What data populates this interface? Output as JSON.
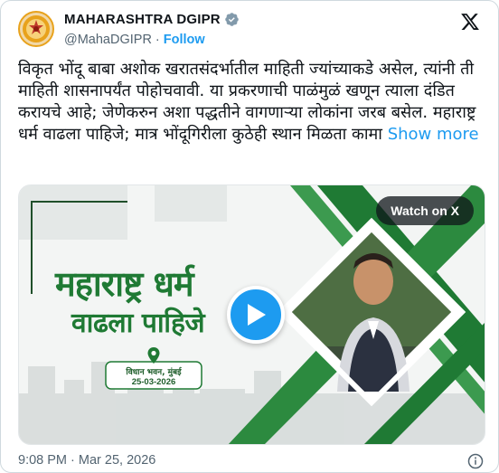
{
  "account": {
    "display_name": "MAHARASHTRA DGIPR",
    "handle": "@MahaDGIPR",
    "separator": "·",
    "follow_label": "Follow"
  },
  "tweet": {
    "text": "विकृत भोंदू बाबा अशोक खरातसंदर्भातील माहिती ज्यांच्याकडे असेल, त्यांनी ती माहिती शासनापर्यंत पोहोचवावी. या प्रकरणाची पाळंमुळं खणून त्याला दंडित करायचे आहे; जेणेकरुन अशा पद्धतीने वागणाऱ्या लोकांना जरब बसेल. महाराष्ट्र धर्म वाढला पाहिजे; मात्र भोंदूगिरीला कुठेही स्थान मिळता कामा",
    "show_more_label": "Show more"
  },
  "media": {
    "watch_label": "Watch on X",
    "headline_line1": "महाराष्ट्र धर्म",
    "headline_line2": "वाढला पाहिजे",
    "venue": "विधान भवन, मुंबई",
    "date": "25-03-2026"
  },
  "footer": {
    "timestamp": "9:08 PM · Mar 25, 2026"
  },
  "colors": {
    "link_blue": "#1d9bf0",
    "headline_green": "#1f7a34",
    "text_dark": "#0f1419",
    "text_muted": "#536471"
  },
  "icons": {
    "verified": "verified-badge-icon",
    "platform": "x-logo-icon",
    "play": "play-icon",
    "location": "map-pin-icon",
    "info": "info-icon"
  }
}
